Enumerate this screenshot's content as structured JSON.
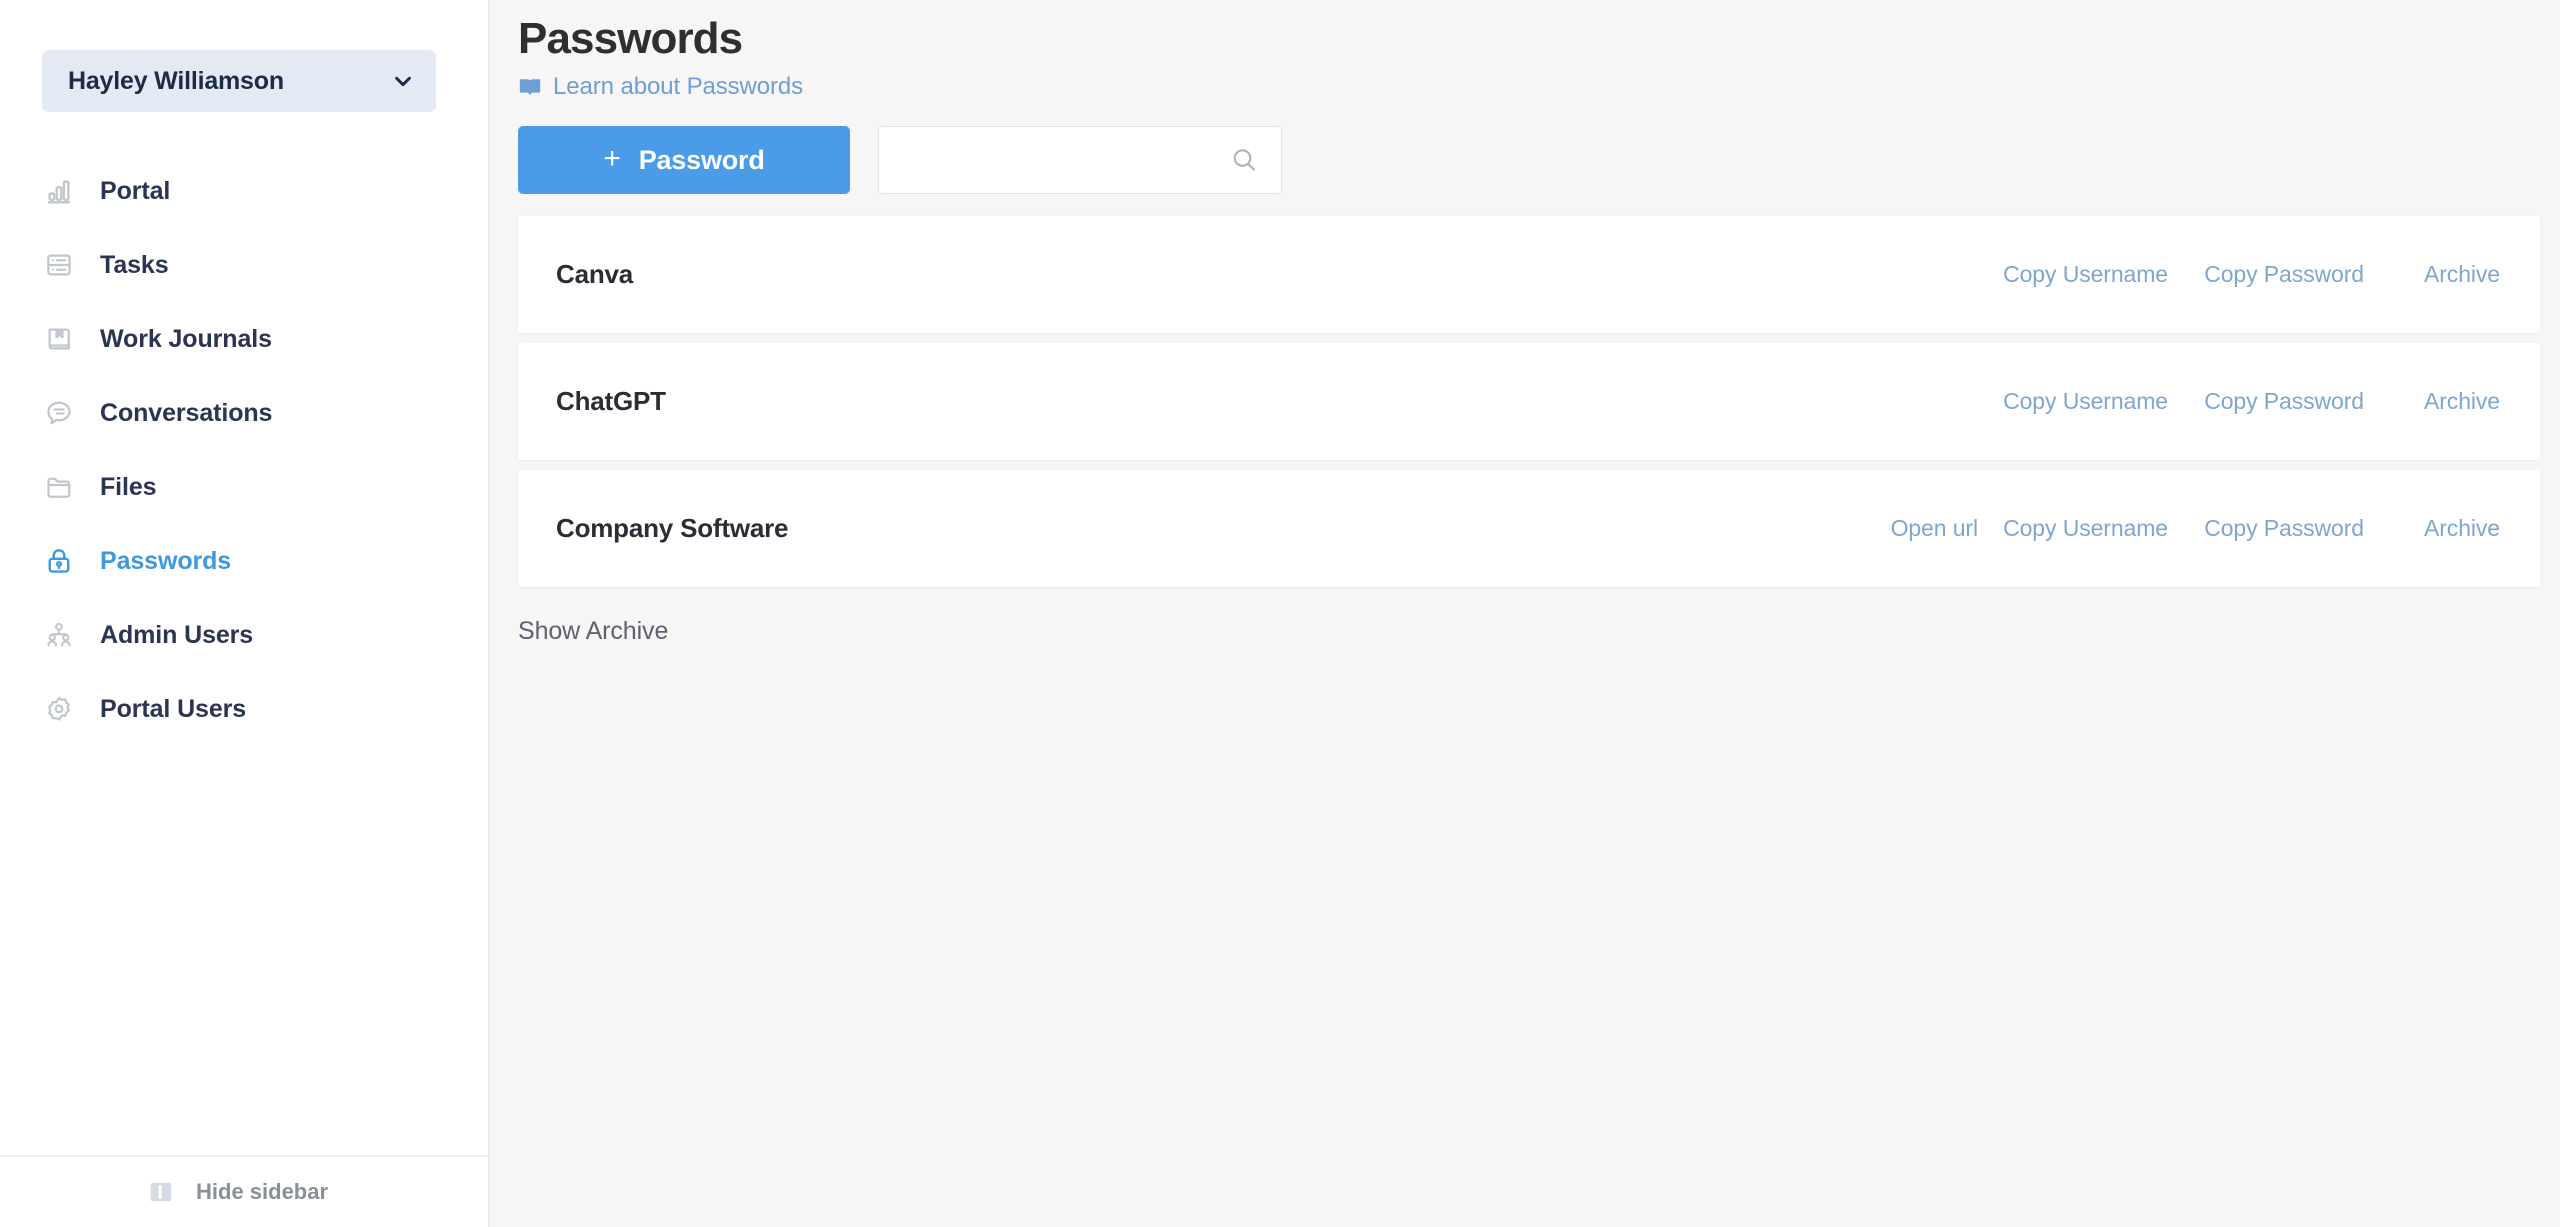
{
  "sidebar": {
    "workspace": {
      "name": "Hayley Williamson",
      "chevron_icon": "chevron-down-icon"
    },
    "items": [
      {
        "label": "Portal",
        "icon": "bar-chart-icon",
        "active": false
      },
      {
        "label": "Tasks",
        "icon": "list-task-icon",
        "active": false
      },
      {
        "label": "Work Journals",
        "icon": "book-icon",
        "active": false
      },
      {
        "label": "Conversations",
        "icon": "chat-bubble-icon",
        "active": false
      },
      {
        "label": "Files",
        "icon": "folder-icon",
        "active": false
      },
      {
        "label": "Passwords",
        "icon": "lock-icon",
        "active": true
      },
      {
        "label": "Admin Users",
        "icon": "users-icon",
        "active": false
      },
      {
        "label": "Portal Users",
        "icon": "gear-icon",
        "active": false
      }
    ],
    "footer": {
      "label": "Hide sidebar",
      "icon": "sidebar-toggle-icon"
    }
  },
  "main": {
    "title": "Passwords",
    "learn_link": {
      "label": "Learn about Passwords",
      "icon": "book-open-icon"
    },
    "toolbar": {
      "add_label": "Password",
      "add_plus": "+",
      "search_value": "",
      "search_placeholder": "",
      "search_icon": "search-icon"
    },
    "rows": [
      {
        "name": "Canva",
        "actions": [
          {
            "label": "Copy Username",
            "key": "copy-username"
          },
          {
            "label": "Copy Password",
            "key": "copy-password"
          },
          {
            "label": "Archive",
            "key": "archive"
          }
        ]
      },
      {
        "name": "ChatGPT",
        "actions": [
          {
            "label": "Copy Username",
            "key": "copy-username"
          },
          {
            "label": "Copy Password",
            "key": "copy-password"
          },
          {
            "label": "Archive",
            "key": "archive"
          }
        ]
      },
      {
        "name": "Company Software",
        "actions": [
          {
            "label": "Open url",
            "key": "open-url"
          },
          {
            "label": "Copy Username",
            "key": "copy-username"
          },
          {
            "label": "Copy Password",
            "key": "copy-password"
          },
          {
            "label": "Archive",
            "key": "archive"
          }
        ]
      }
    ],
    "show_archive_label": "Show Archive"
  },
  "colors": {
    "accent_blue": "#4a9be8",
    "active_nav": "#3e9ae0",
    "link_blue": "#7fa6cf",
    "sidebar_bg": "#ffffff",
    "content_bg": "#f7f5f5",
    "card_bg": "#ffffff",
    "workspace_bg": "#e4eaf4",
    "nav_text": "#2b3553"
  }
}
